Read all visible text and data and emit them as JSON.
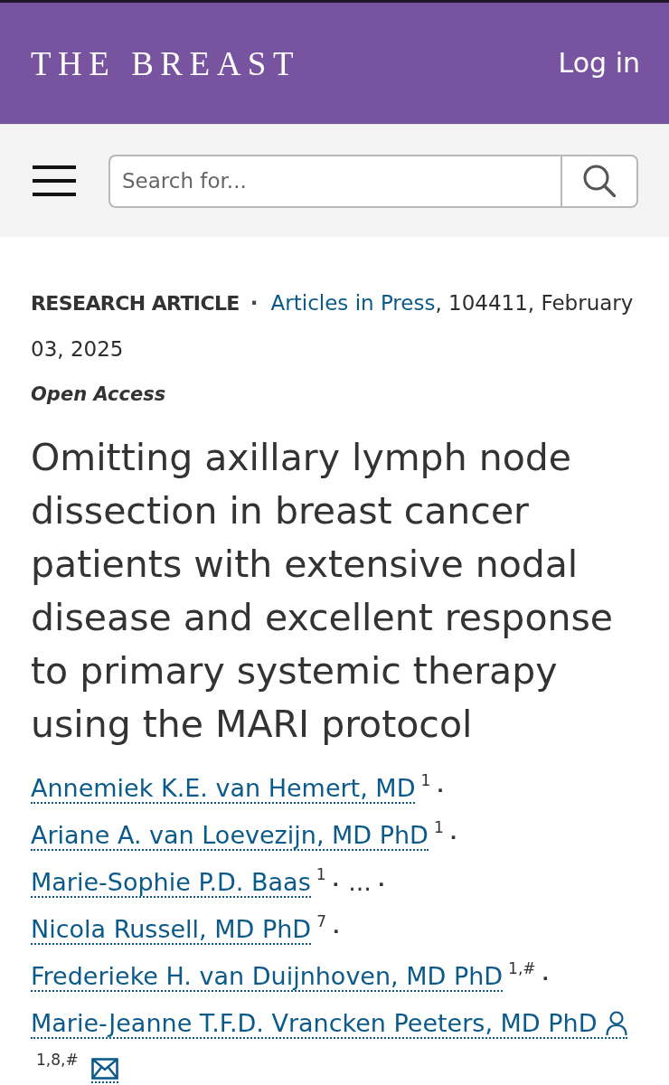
{
  "header": {
    "logo": "THE BREAST",
    "login": "Log in"
  },
  "toolbar": {
    "search": {
      "placeholder": "Search for..."
    }
  },
  "article": {
    "type_label": "RESEARCH ARTICLE",
    "separator": "·",
    "issue_link": "Articles in Press",
    "details": ", 104411, February 03, 2025",
    "access": "Open Access",
    "title": "Omitting axillary lymph node dissection in breast cancer patients with extensive nodal disease and excellent response to primary systemic therapy using the MARI protocol",
    "authors": [
      {
        "kind": "author",
        "name": "Annemiek K.E. van Hemert, MD",
        "affiliations": "1",
        "separator": "·",
        "corresponding": false,
        "email": false
      },
      {
        "kind": "author",
        "name": "Ariane A. van Loevezijn, MD PhD",
        "affiliations": "1",
        "separator": "·",
        "corresponding": false,
        "email": false
      },
      {
        "kind": "author",
        "name": "Marie-Sophie P.D. Baas",
        "affiliations": "1",
        "separator": "·",
        "corresponding": false,
        "email": false
      },
      {
        "kind": "more",
        "label": "...",
        "separator": "·"
      },
      {
        "kind": "author",
        "name": "Nicola Russell, MD PhD",
        "affiliations": "7",
        "separator": "·",
        "corresponding": false,
        "email": false
      },
      {
        "kind": "author",
        "name": "Frederieke H. van Duijnhoven, MD PhD",
        "affiliations": "1,#",
        "separator": "·",
        "corresponding": false,
        "email": false
      },
      {
        "kind": "author",
        "name": "Marie-Jeanne T.F.D. Vrancken Peeters, MD PhD",
        "affiliations": "1,8,#",
        "corresponding": true,
        "email": true
      }
    ]
  }
}
